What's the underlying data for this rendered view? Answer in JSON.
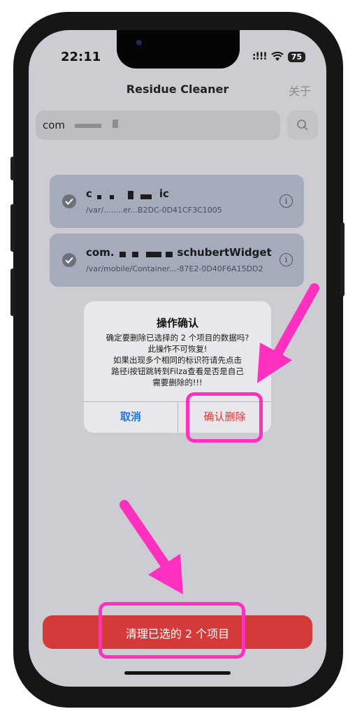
{
  "status_bar": {
    "time": "22:11",
    "signal": ":!!!",
    "battery": "75"
  },
  "nav": {
    "title": "Residue Cleaner",
    "about": "关于"
  },
  "search": {
    "value": "com"
  },
  "items": [
    {
      "title_prefix": "c",
      "title_suffix": "ic",
      "path": "/var/........er...B2DC-0D41CF3C1005",
      "checked": true
    },
    {
      "title_prefix": "com.",
      "title_suffix": "schubertWidget",
      "path": "/var/mobile/Container...-87E2-0D40F6A15DD2",
      "checked": true
    }
  ],
  "alert": {
    "title": "操作确认",
    "message": "确定要删除已选择的 2 个项目的数据吗?\n此操作不可恢复!\n如果出现多个相同的标识符请先点击路径i按钮跳转到Filza查看是否是自己需要删除的!!!",
    "cancel": "取消",
    "confirm": "确认删除"
  },
  "bottom_button": {
    "label": "清理已选的 2 个项目"
  },
  "colors": {
    "accent": "#1977e6",
    "destructive": "#e0393b",
    "clean_button": "#d53a3a",
    "highlight": "#ff2fbf"
  }
}
